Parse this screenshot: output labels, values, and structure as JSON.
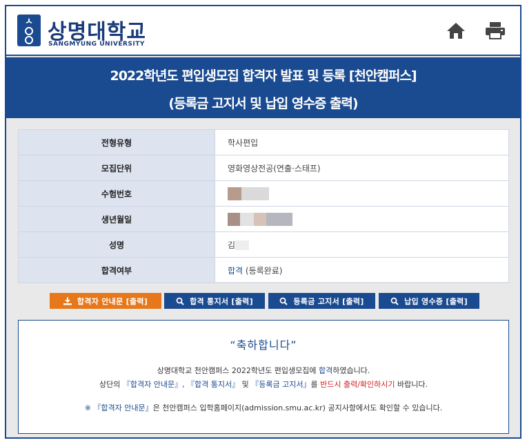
{
  "header": {
    "logo_name": "상명대학교",
    "logo_sub": "SANGMYUNG UNIVERSITY",
    "home_icon": "home-icon",
    "print_icon": "printer-icon"
  },
  "title": {
    "line1": "2022학년도 편입생모집 합격자 발표 및 등록 [천안캠퍼스]",
    "line2": "(등록금 고지서 및 납입 영수증 출력)"
  },
  "info": {
    "rows": [
      {
        "label": "전형유형",
        "value": "학사편입"
      },
      {
        "label": "모집단위",
        "value": "영화영상전공(연출·스태프)"
      },
      {
        "label": "수험번호",
        "value": ""
      },
      {
        "label": "생년월일",
        "value": ""
      },
      {
        "label": "성명",
        "value": "김"
      },
      {
        "label": "합격여부",
        "value": "합격",
        "value_suffix": " (등록완료)"
      }
    ]
  },
  "buttons": {
    "guide": "합격자 안내문 [출력]",
    "notice": "합격 통지서 [출력]",
    "bill": "등록금 고지서 [출력]",
    "receipt": "납입 영수증 [출력]"
  },
  "message": {
    "congrats": "“축하합니다”",
    "l1_a": "상명대학교 천안캠퍼스 2022학년도 편입생모집에 ",
    "l1_b": "합격",
    "l1_c": "하였습니다.",
    "l2_a": "상단의 ",
    "l2_b": "『합격자 안내문』, 『합격 통지서』",
    "l2_c": " 및 ",
    "l2_d": "『등록금 고지서』",
    "l2_e": "를 ",
    "l2_f": "반드시 출력/확인하시기",
    "l2_g": " 바랍니다.",
    "l3_a": "※ 『합격자 안내문』",
    "l3_b": "은 천안캠퍼스 입학홈페이지(admission.smu.ac.kr) 공지사항에서도 확인할 수 있습니다."
  },
  "colors": {
    "brand_blue": "#1a4a8f",
    "orange": "#e6771a",
    "red": "#d62020"
  }
}
